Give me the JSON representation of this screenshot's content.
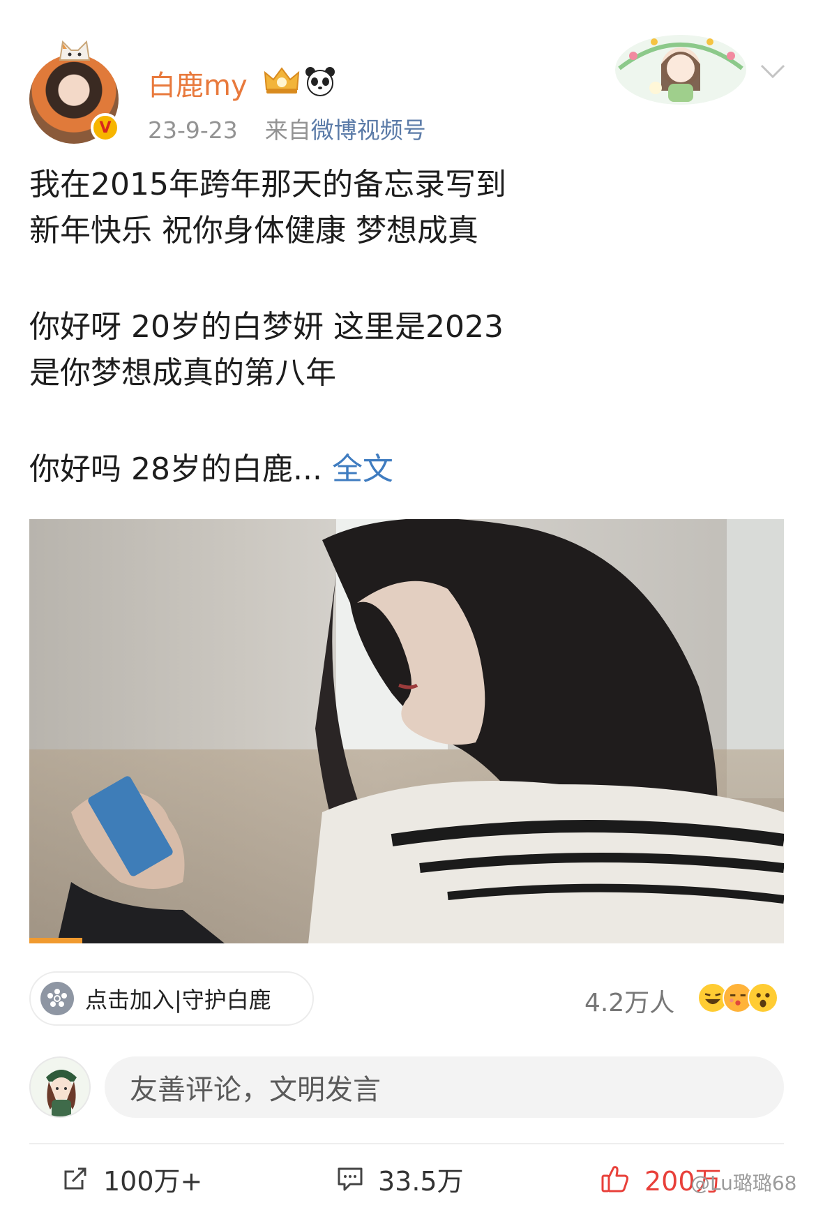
{
  "header": {
    "username": "白鹿my",
    "date": "23-9-23",
    "via": "来自",
    "source": "微博视频号",
    "verified_mark": "V"
  },
  "post": {
    "lines": [
      "我在2015年跨年那天的备忘录写到",
      "新年快乐 祝你身体健康 梦想成真",
      "你好呀 20岁的白梦妍 这里是2023",
      "是你梦想成真的第八年",
      "你好吗 28岁的白鹿..."
    ],
    "more_label": "全文"
  },
  "video": {
    "progress_percent": 7
  },
  "supporters": {
    "join_label": "点击加入|守护白鹿",
    "reaction_count": "4.2万人"
  },
  "comment_box": {
    "placeholder": "友善评论，文明发言"
  },
  "actions": {
    "share_count": "100万+",
    "comment_count": "33.5万",
    "like_count": "200万"
  },
  "watermark": "@Lu璐璐68",
  "colors": {
    "username": "#e8793c",
    "link": "#3f7cc0",
    "like_active": "#e8403a",
    "progress": "#f09a2f"
  },
  "icons": [
    "cat-ear-icon",
    "verified-icon",
    "crown-badge-icon",
    "panda-badge-icon",
    "chevron-down-icon",
    "flower-icon",
    "share-icon",
    "comment-icon",
    "thumbs-up-icon"
  ]
}
